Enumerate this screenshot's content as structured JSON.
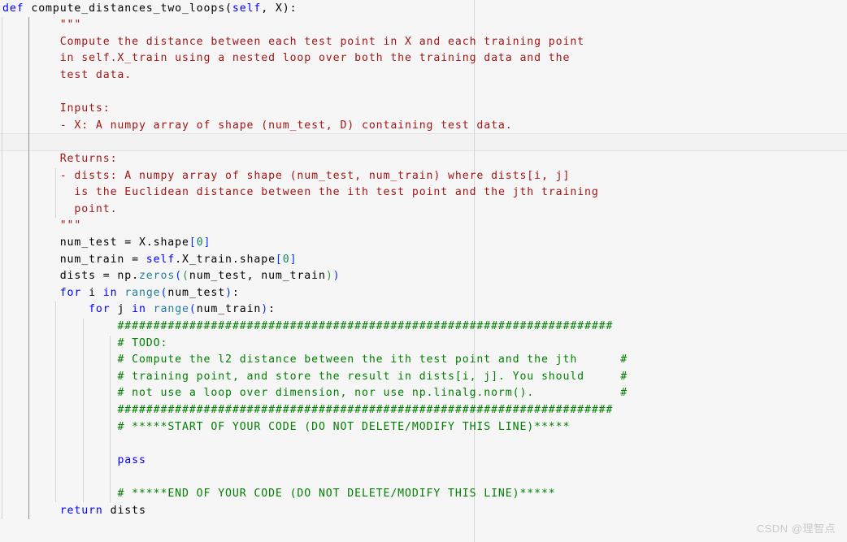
{
  "editor": {
    "background_color": "#f6f6f6",
    "foreground_color": "#000000",
    "ruler_column_color": "#d6d6d6",
    "indent_guide_color": "#d3d3d3",
    "indent_guide_active_color": "#939393",
    "highlight_band_color": "#f2f2f2",
    "language": "python",
    "font_size_px": 13.2,
    "line_height_px": 20.6
  },
  "syntax_colors": {
    "keyword": "#0000ff",
    "function": "#267f99",
    "number": "#098658",
    "string": "#a31515",
    "comment": "#008000",
    "bracket_level_1": "#0431fa",
    "bracket_level_2": "#319331",
    "plain": "#000000"
  },
  "watermark": {
    "text": "CSDN @理智点"
  },
  "code": {
    "lines": [
      {
        "indent": 0,
        "tokens": [
          {
            "t": "def",
            "c": "kw"
          },
          {
            "t": " compute_distances_two_loops(",
            "c": "pl"
          },
          {
            "t": "self",
            "c": "kw"
          },
          {
            "t": ", X):",
            "c": "pl"
          }
        ]
      },
      {
        "indent": 8,
        "tokens": [
          {
            "t": "\"\"\"",
            "c": "str"
          }
        ]
      },
      {
        "indent": 8,
        "tokens": [
          {
            "t": "Compute the distance between each test point in X and each training point",
            "c": "str"
          }
        ]
      },
      {
        "indent": 8,
        "tokens": [
          {
            "t": "in self.X_train using a nested loop over both the training data and the",
            "c": "str"
          }
        ]
      },
      {
        "indent": 8,
        "tokens": [
          {
            "t": "test data.",
            "c": "str"
          }
        ]
      },
      {
        "indent": 8,
        "tokens": []
      },
      {
        "indent": 8,
        "tokens": [
          {
            "t": "Inputs:",
            "c": "str"
          }
        ]
      },
      {
        "indent": 8,
        "tokens": [
          {
            "t": "- X: A numpy array of shape (num_test, D) containing test data.",
            "c": "str"
          }
        ]
      },
      {
        "indent": 8,
        "tokens": []
      },
      {
        "indent": 8,
        "tokens": [
          {
            "t": "Returns:",
            "c": "str"
          }
        ]
      },
      {
        "indent": 8,
        "tokens": [
          {
            "t": "- dists: A numpy array of shape (num_test, num_train) where dists[i, j]",
            "c": "str"
          }
        ]
      },
      {
        "indent": 10,
        "tokens": [
          {
            "t": "is the Euclidean distance between the ith test point and the jth training",
            "c": "str"
          }
        ]
      },
      {
        "indent": 10,
        "tokens": [
          {
            "t": "point.",
            "c": "str"
          }
        ]
      },
      {
        "indent": 8,
        "tokens": [
          {
            "t": "\"\"\"",
            "c": "str"
          }
        ]
      },
      {
        "indent": 8,
        "tokens": [
          {
            "t": "num_test = X.shape",
            "c": "pl"
          },
          {
            "t": "[",
            "c": "br0"
          },
          {
            "t": "0",
            "c": "num"
          },
          {
            "t": "]",
            "c": "br0"
          }
        ]
      },
      {
        "indent": 8,
        "tokens": [
          {
            "t": "num_train = ",
            "c": "pl"
          },
          {
            "t": "self",
            "c": "kw"
          },
          {
            "t": ".X_train.shape",
            "c": "pl"
          },
          {
            "t": "[",
            "c": "br0"
          },
          {
            "t": "0",
            "c": "num"
          },
          {
            "t": "]",
            "c": "br0"
          }
        ]
      },
      {
        "indent": 8,
        "tokens": [
          {
            "t": "dists = np.",
            "c": "pl"
          },
          {
            "t": "zeros",
            "c": "fn"
          },
          {
            "t": "(",
            "c": "br0"
          },
          {
            "t": "(",
            "c": "br1"
          },
          {
            "t": "num_test, num_train",
            "c": "pl"
          },
          {
            "t": ")",
            "c": "br1"
          },
          {
            "t": ")",
            "c": "br0"
          }
        ]
      },
      {
        "indent": 8,
        "tokens": [
          {
            "t": "for",
            "c": "kw"
          },
          {
            "t": " i ",
            "c": "pl"
          },
          {
            "t": "in",
            "c": "kw"
          },
          {
            "t": " ",
            "c": "pl"
          },
          {
            "t": "range",
            "c": "fn"
          },
          {
            "t": "(",
            "c": "br0"
          },
          {
            "t": "num_test",
            "c": "pl"
          },
          {
            "t": ")",
            "c": "br0"
          },
          {
            "t": ":",
            "c": "pl"
          }
        ]
      },
      {
        "indent": 12,
        "tokens": [
          {
            "t": "for",
            "c": "kw"
          },
          {
            "t": " j ",
            "c": "pl"
          },
          {
            "t": "in",
            "c": "kw"
          },
          {
            "t": " ",
            "c": "pl"
          },
          {
            "t": "range",
            "c": "fn"
          },
          {
            "t": "(",
            "c": "br0"
          },
          {
            "t": "num_train",
            "c": "pl"
          },
          {
            "t": ")",
            "c": "br0"
          },
          {
            "t": ":",
            "c": "pl"
          }
        ]
      },
      {
        "indent": 16,
        "tokens": [
          {
            "t": "#####################################################################",
            "c": "cmt"
          }
        ]
      },
      {
        "indent": 16,
        "tokens": [
          {
            "t": "# TODO:",
            "c": "cmt"
          }
        ]
      },
      {
        "indent": 16,
        "tokens": [
          {
            "t": "# Compute the l2 distance between the ith test point and the jth      #",
            "c": "cmt"
          }
        ]
      },
      {
        "indent": 16,
        "tokens": [
          {
            "t": "# training point, and store the result in dists[i, j]. You should     #",
            "c": "cmt"
          }
        ]
      },
      {
        "indent": 16,
        "tokens": [
          {
            "t": "# not use a loop over dimension, nor use np.linalg.norm().            #",
            "c": "cmt"
          }
        ]
      },
      {
        "indent": 16,
        "tokens": [
          {
            "t": "#####################################################################",
            "c": "cmt"
          }
        ]
      },
      {
        "indent": 16,
        "tokens": [
          {
            "t": "# *****START OF YOUR CODE (DO NOT DELETE/MODIFY THIS LINE)*****",
            "c": "cmt"
          }
        ]
      },
      {
        "indent": 16,
        "tokens": []
      },
      {
        "indent": 16,
        "tokens": [
          {
            "t": "pass",
            "c": "kw"
          }
        ]
      },
      {
        "indent": 16,
        "tokens": []
      },
      {
        "indent": 16,
        "tokens": [
          {
            "t": "# *****END OF YOUR CODE (DO NOT DELETE/MODIFY THIS LINE)*****",
            "c": "cmt"
          }
        ]
      },
      {
        "indent": 8,
        "tokens": [
          {
            "t": "return",
            "c": "kw"
          },
          {
            "t": " dists",
            "c": "pl"
          }
        ]
      }
    ],
    "highlighted_line_index": 8,
    "ruler_column": 80,
    "guides": [
      {
        "indent": 0,
        "from_line": 1,
        "to_line": 30,
        "active": false
      },
      {
        "indent": 4,
        "from_line": 1,
        "to_line": 30,
        "active": true
      },
      {
        "indent": 8,
        "from_line": 10,
        "to_line": 12,
        "active": false
      },
      {
        "indent": 8,
        "from_line": 18,
        "to_line": 29,
        "active": false
      },
      {
        "indent": 12,
        "from_line": 19,
        "to_line": 29,
        "active": false
      },
      {
        "indent": 16,
        "from_line": 20,
        "to_line": 29,
        "active": false
      }
    ]
  }
}
